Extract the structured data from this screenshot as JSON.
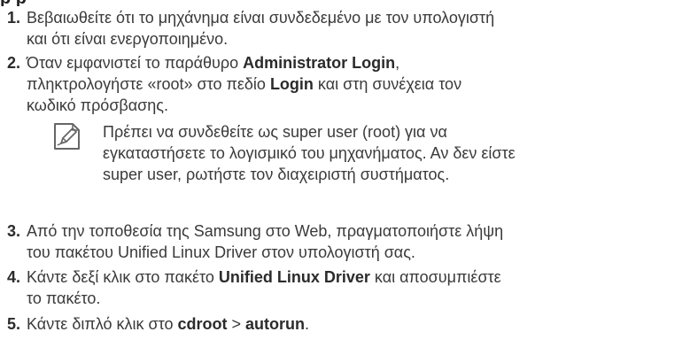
{
  "heading_fragment": "p           p",
  "steps": [
    {
      "number": "1.",
      "lines": [
        [
          "Βεβαιωθείτε ότι το μηχάνημα είναι συνδεδεμένο με τον υπολογιστή"
        ],
        [
          "και ότι είναι ενεργοποιημένο."
        ]
      ]
    },
    {
      "number": "2.",
      "line1_a": "Όταν εμφανιστεί το παράθυρο ",
      "line1_b": "Administrator Login",
      "line1_c": ",",
      "line2_a": "πληκτρολογήστε «root» στο πεδίο ",
      "line2_b": "Login",
      "line2_c": " και στη συνέχεια τον",
      "line3": "κωδικό πρόσβασης."
    },
    {
      "number": "3.",
      "line1": "Από την τοποθεσία της Samsung στο Web, πραγματοποιήστε λήψη",
      "line2": "του πακέτου Unified Linux Driver στον υπολογιστή σας."
    },
    {
      "number": "4.",
      "line1_a": "Κάντε δεξί κλικ στο πακέτο ",
      "line1_b": "Unified Linux Driver",
      "line1_c": " και αποσυμπιέστε",
      "line2": "το πακέτο."
    },
    {
      "number": "5.",
      "line1_a": "Κάντε διπλό κλικ στο ",
      "line1_b": "cdroot",
      "line1_c": " > ",
      "line1_d": "autorun",
      "line1_e": "."
    }
  ],
  "note": {
    "icon": "note-pencil-icon",
    "line1": "Πρέπει να συνδεθείτε ως super user (root) για να",
    "line2": "εγκαταστήσετε το λογισμικό του μηχανήματος. Αν δεν είστε",
    "line3": "super user, ρωτήστε τον διαχειριστή συστήματος."
  },
  "colors": {
    "text": "#3a3a3a",
    "bold": "#2b2b2b",
    "icon_stroke": "#666666"
  }
}
